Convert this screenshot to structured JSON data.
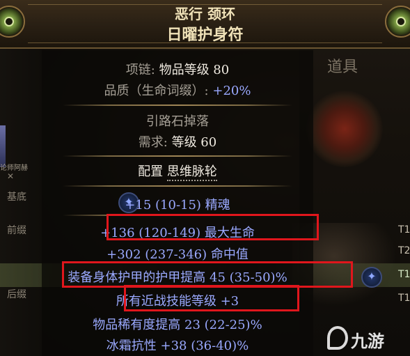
{
  "background": {
    "panel_title": "道具",
    "left_labels": [
      "基底",
      "前缀",
      "后缀"
    ],
    "left_small_text": "论师阿赫",
    "tiers": [
      "T1",
      "T2",
      "T1",
      "T1"
    ]
  },
  "item": {
    "name_line1": "恶行 颈环",
    "name_line2": "日曜护身符",
    "type_prefix": "项链:",
    "item_level": "物品等级 80",
    "quality_prefix": "品质（生命词缀）:",
    "quality_value": "+20%",
    "source": "引路石掉落",
    "requirement_prefix": "需求:",
    "requirement_value": "等级 60",
    "config_prefix": "配置",
    "config_value": "思维脉轮",
    "implicit": "+15 (10-15) 精魂",
    "mods": [
      "+136 (120-149) 最大生命",
      "+302 (237-346) 命中值",
      "装备身体护甲的护甲提高 45 (35-50)%",
      "所有近战技能等级 +3",
      "物品稀有度提高 23 (22-25)%",
      "冰霜抗性 +38 (36-40)%"
    ]
  },
  "watermark": "九游",
  "colors": {
    "header_text": "#f0e2b8",
    "magic_mod": "#9aa9ff",
    "label_gray": "#a6a096",
    "highlight_box": "#e0161c"
  }
}
